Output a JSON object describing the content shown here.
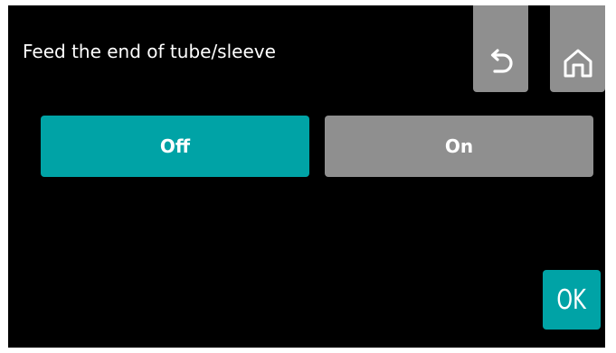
{
  "header": {
    "title": "Feed the end of tube/sleeve"
  },
  "icons": {
    "back": "undo-arrow-icon",
    "home": "home-icon"
  },
  "toggle": {
    "off_label": "Off",
    "on_label": "On",
    "selected": "Off"
  },
  "footer": {
    "ok_label": "OK"
  },
  "colors": {
    "background": "#000000",
    "accent": "#00a3a6",
    "inactive": "#8f8f8f",
    "text": "#ffffff"
  }
}
